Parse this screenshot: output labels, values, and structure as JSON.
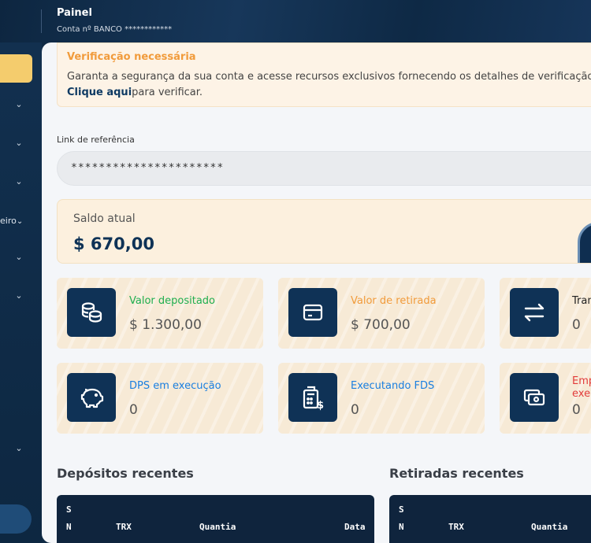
{
  "header": {
    "title": "Painel",
    "account": "Conta nº BANCO ************"
  },
  "sidebar": {
    "partial_label": "eiro"
  },
  "alert": {
    "title": "Verificação necessária",
    "text": "Garanta a segurança da sua conta e acesse recursos exclusivos fornecendo os detalhes de verificação n",
    "link": "Clique aqui",
    "link_suffix": "para verificar."
  },
  "referral": {
    "label": "Link de referência",
    "value": "**********************"
  },
  "balance": {
    "label": "Saldo atual",
    "value": "$ 670,00"
  },
  "cards": [
    {
      "label": "Valor depositado",
      "value": "$ 1.300,00",
      "color": "#1fae4f",
      "icon": "coins-icon"
    },
    {
      "label": "Valor de retirada",
      "value": "$ 700,00",
      "color": "#f19b3b",
      "icon": "credit-card-icon"
    },
    {
      "label": "Tran",
      "value": "0",
      "color": "#222222",
      "icon": "transfer-arrows-icon"
    },
    {
      "label": "DPS em execução",
      "value": "0",
      "color": "#1a7fe0",
      "icon": "piggy-bank-icon"
    },
    {
      "label": "Executando FDS",
      "value": "0",
      "color": "#1a7fe0",
      "icon": "calculator-dollar-icon"
    },
    {
      "label": "Emp",
      "label2": "exe",
      "value": "0",
      "color": "#e23b3b",
      "icon": "cash-icon"
    }
  ],
  "recent_deposits": {
    "title": "Depósitos recentes",
    "columns": [
      "S",
      "N",
      "TRX",
      "Quantia",
      "Data"
    ]
  },
  "recent_withdrawals": {
    "title": "Retiradas recentes",
    "columns": [
      "S",
      "N",
      "TRX",
      "Quantia"
    ]
  }
}
